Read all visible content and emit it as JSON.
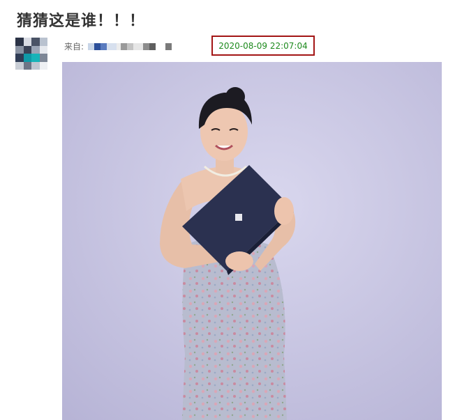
{
  "post": {
    "title": "猜猜这是谁！！！",
    "source_label": "来自:",
    "timestamp": "2020-08-09 22:07:04"
  },
  "colors": {
    "timestamp_text": "#1d8a1d",
    "timestamp_border": "#a31515",
    "photo_background": "#c5c3e0"
  },
  "icons": {
    "avatar": "pixelated-avatar",
    "source_name": "pixelated-censored-text"
  }
}
